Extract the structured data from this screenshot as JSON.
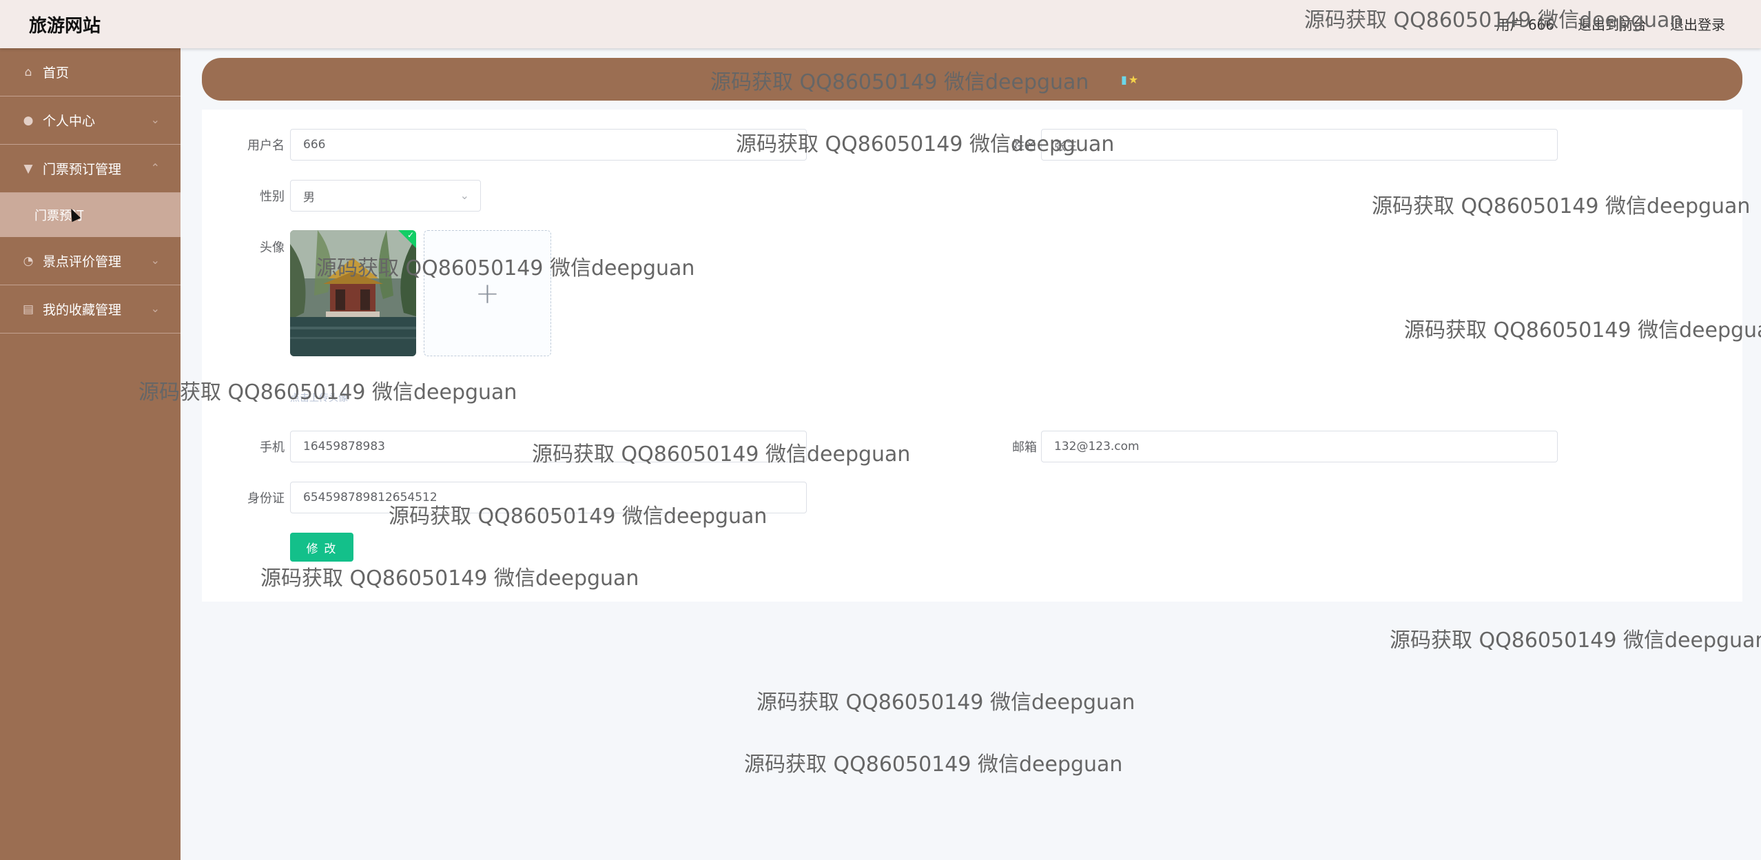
{
  "header": {
    "brand": "旅游网站",
    "user_label": "用户 666",
    "back_label": "退出到前台",
    "logout_label": "退出登录"
  },
  "sidebar": {
    "items": [
      {
        "label": "首页",
        "icon": "home-icon"
      },
      {
        "label": "个人中心",
        "icon": "user-icon"
      },
      {
        "label": "门票预订管理",
        "icon": "ticket-icon"
      },
      {
        "label": "景点评价管理",
        "icon": "comment-icon"
      },
      {
        "label": "我的收藏管理",
        "icon": "favorite-icon"
      }
    ],
    "active_sub": "门票预订"
  },
  "form": {
    "username_label": "用户名",
    "username_value": "666",
    "name_label": "姓名",
    "name_value": "张三",
    "gender_label": "性别",
    "gender_value": "男",
    "avatar_label": "头像",
    "upload_tip": "点击上传头像",
    "phone_label": "手机",
    "phone_value": "16459878983",
    "email_label": "邮箱",
    "email_value": "132@123.com",
    "idcard_label": "身份证",
    "idcard_value": "654598789812654512",
    "submit_label": "修 改"
  },
  "watermark": "源码获取 QQ86050149 微信deepguan",
  "colors": {
    "sidebar": "#9b6e52",
    "topbar": "#f3ebe9",
    "submit": "#13c08a"
  }
}
